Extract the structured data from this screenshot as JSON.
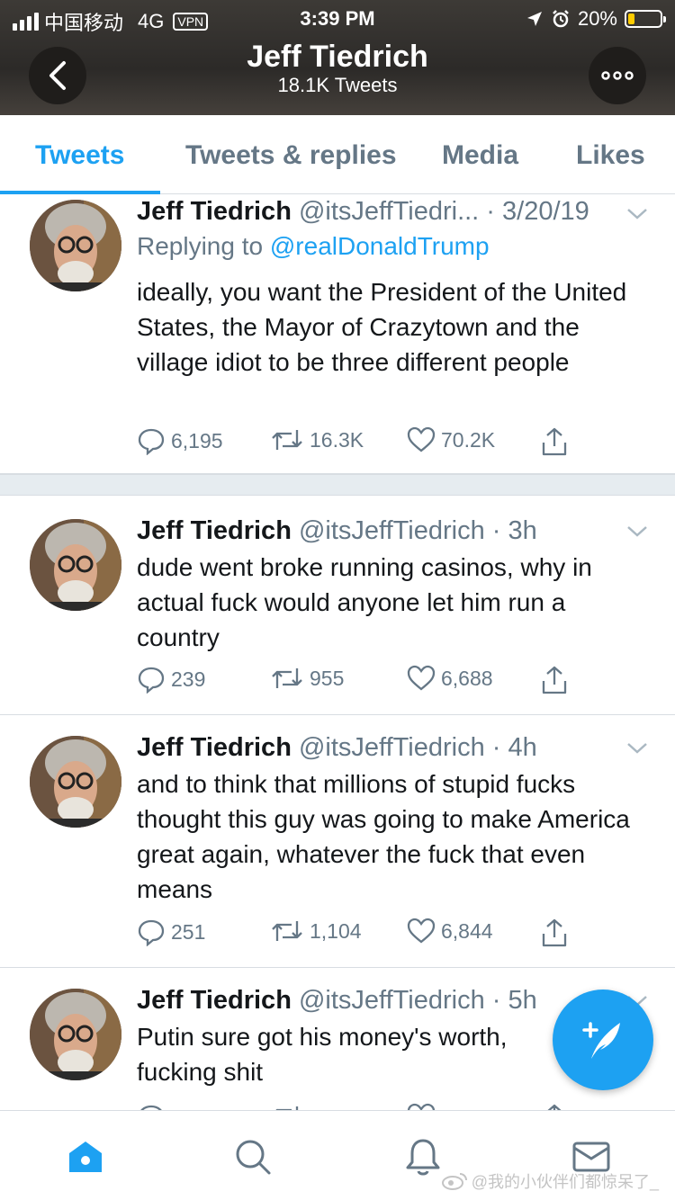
{
  "status_bar": {
    "carrier": "中国移动",
    "network": "4G",
    "vpn": "VPN",
    "time": "3:39 PM",
    "battery": "20%"
  },
  "header": {
    "title": "Jeff Tiedrich",
    "subtitle": "18.1K Tweets"
  },
  "tabs": [
    {
      "label": "Tweets",
      "active": true
    },
    {
      "label": "Tweets & replies",
      "active": false
    },
    {
      "label": "Media",
      "active": false
    },
    {
      "label": "Likes",
      "active": false
    }
  ],
  "tweets": [
    {
      "name": "Jeff Tiedrich",
      "handle_time": "@itsJeffTiedri... · 3/20/19",
      "replying_prefix": "Replying to",
      "replying_to": "@realDonaldTrump",
      "text": "ideally, you want the President of the United States, the Mayor of Crazytown and the village idiot to be three different people",
      "replies": "6,195",
      "retweets": "16.3K",
      "likes": "70.2K"
    },
    {
      "name": "Jeff Tiedrich",
      "handle_time": "@itsJeffTiedrich · 3h",
      "text": "dude went broke running casinos, why in actual fuck would anyone let him run a country",
      "replies": "239",
      "retweets": "955",
      "likes": "6,688"
    },
    {
      "name": "Jeff Tiedrich",
      "handle_time": "@itsJeffTiedrich · 4h",
      "text": "and to think that millions of stupid fucks thought this guy was going to make America great again, whatever the fuck that even means",
      "replies": "251",
      "retweets": "1,104",
      "likes": "6,844"
    },
    {
      "name": "Jeff Tiedrich",
      "handle_time": "@itsJeffTiedrich · 5h",
      "text": "Putin sure got his money's worth, fucking shit"
    }
  ],
  "watermark": "@我的小伙伴们都惊呆了_",
  "colors": {
    "accent": "#1da1f2",
    "muted": "#657786",
    "text": "#14171a",
    "divider": "#e6ecf0"
  },
  "icons": [
    "back-icon",
    "more-icon",
    "reply-icon",
    "retweet-icon",
    "like-icon",
    "share-icon",
    "compose-icon",
    "home-icon",
    "search-icon",
    "notifications-icon",
    "messages-icon",
    "chevron-down-icon"
  ]
}
